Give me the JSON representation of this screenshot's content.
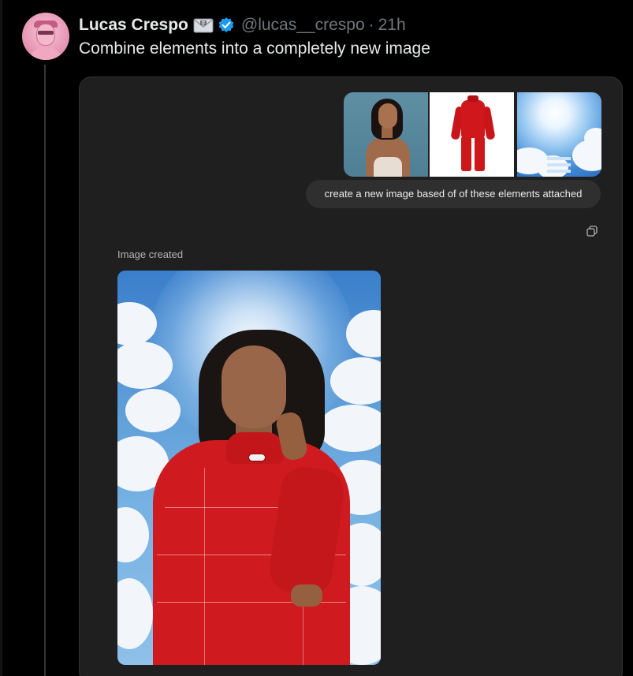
{
  "tweet": {
    "author_name": "Lucas Crespo",
    "handle": "@lucas__crespo",
    "separator": "·",
    "time": "21h",
    "text": "Combine elements into a completely new image"
  },
  "icons": {
    "mail": "envelope-icon",
    "verified": "verified-badge-icon",
    "copy": "copy-icon"
  },
  "chat": {
    "prompt": "create a new image based of of these elements attached",
    "status": "Image created",
    "attachments": [
      "woman-portrait",
      "red-racing-suit",
      "sky-clouds"
    ]
  },
  "colors": {
    "background": "#000000",
    "card": "#1f1f1f",
    "verified": "#1d9bf0",
    "muted_text": "#71767b"
  }
}
